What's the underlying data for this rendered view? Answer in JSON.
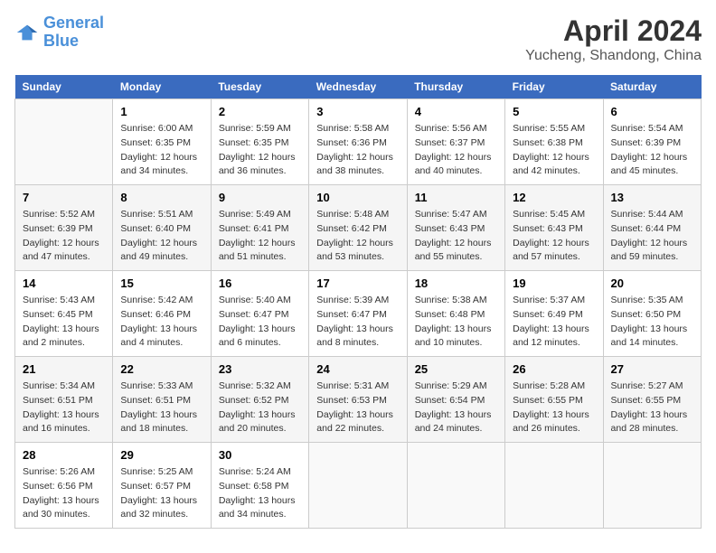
{
  "header": {
    "logo_line1": "General",
    "logo_line2": "Blue",
    "main_title": "April 2024",
    "subtitle": "Yucheng, Shandong, China"
  },
  "days_of_week": [
    "Sunday",
    "Monday",
    "Tuesday",
    "Wednesday",
    "Thursday",
    "Friday",
    "Saturday"
  ],
  "weeks": [
    [
      {
        "day": "",
        "info": ""
      },
      {
        "day": "1",
        "info": "Sunrise: 6:00 AM\nSunset: 6:35 PM\nDaylight: 12 hours\nand 34 minutes."
      },
      {
        "day": "2",
        "info": "Sunrise: 5:59 AM\nSunset: 6:35 PM\nDaylight: 12 hours\nand 36 minutes."
      },
      {
        "day": "3",
        "info": "Sunrise: 5:58 AM\nSunset: 6:36 PM\nDaylight: 12 hours\nand 38 minutes."
      },
      {
        "day": "4",
        "info": "Sunrise: 5:56 AM\nSunset: 6:37 PM\nDaylight: 12 hours\nand 40 minutes."
      },
      {
        "day": "5",
        "info": "Sunrise: 5:55 AM\nSunset: 6:38 PM\nDaylight: 12 hours\nand 42 minutes."
      },
      {
        "day": "6",
        "info": "Sunrise: 5:54 AM\nSunset: 6:39 PM\nDaylight: 12 hours\nand 45 minutes."
      }
    ],
    [
      {
        "day": "7",
        "info": "Sunrise: 5:52 AM\nSunset: 6:39 PM\nDaylight: 12 hours\nand 47 minutes."
      },
      {
        "day": "8",
        "info": "Sunrise: 5:51 AM\nSunset: 6:40 PM\nDaylight: 12 hours\nand 49 minutes."
      },
      {
        "day": "9",
        "info": "Sunrise: 5:49 AM\nSunset: 6:41 PM\nDaylight: 12 hours\nand 51 minutes."
      },
      {
        "day": "10",
        "info": "Sunrise: 5:48 AM\nSunset: 6:42 PM\nDaylight: 12 hours\nand 53 minutes."
      },
      {
        "day": "11",
        "info": "Sunrise: 5:47 AM\nSunset: 6:43 PM\nDaylight: 12 hours\nand 55 minutes."
      },
      {
        "day": "12",
        "info": "Sunrise: 5:45 AM\nSunset: 6:43 PM\nDaylight: 12 hours\nand 57 minutes."
      },
      {
        "day": "13",
        "info": "Sunrise: 5:44 AM\nSunset: 6:44 PM\nDaylight: 12 hours\nand 59 minutes."
      }
    ],
    [
      {
        "day": "14",
        "info": "Sunrise: 5:43 AM\nSunset: 6:45 PM\nDaylight: 13 hours\nand 2 minutes."
      },
      {
        "day": "15",
        "info": "Sunrise: 5:42 AM\nSunset: 6:46 PM\nDaylight: 13 hours\nand 4 minutes."
      },
      {
        "day": "16",
        "info": "Sunrise: 5:40 AM\nSunset: 6:47 PM\nDaylight: 13 hours\nand 6 minutes."
      },
      {
        "day": "17",
        "info": "Sunrise: 5:39 AM\nSunset: 6:47 PM\nDaylight: 13 hours\nand 8 minutes."
      },
      {
        "day": "18",
        "info": "Sunrise: 5:38 AM\nSunset: 6:48 PM\nDaylight: 13 hours\nand 10 minutes."
      },
      {
        "day": "19",
        "info": "Sunrise: 5:37 AM\nSunset: 6:49 PM\nDaylight: 13 hours\nand 12 minutes."
      },
      {
        "day": "20",
        "info": "Sunrise: 5:35 AM\nSunset: 6:50 PM\nDaylight: 13 hours\nand 14 minutes."
      }
    ],
    [
      {
        "day": "21",
        "info": "Sunrise: 5:34 AM\nSunset: 6:51 PM\nDaylight: 13 hours\nand 16 minutes."
      },
      {
        "day": "22",
        "info": "Sunrise: 5:33 AM\nSunset: 6:51 PM\nDaylight: 13 hours\nand 18 minutes."
      },
      {
        "day": "23",
        "info": "Sunrise: 5:32 AM\nSunset: 6:52 PM\nDaylight: 13 hours\nand 20 minutes."
      },
      {
        "day": "24",
        "info": "Sunrise: 5:31 AM\nSunset: 6:53 PM\nDaylight: 13 hours\nand 22 minutes."
      },
      {
        "day": "25",
        "info": "Sunrise: 5:29 AM\nSunset: 6:54 PM\nDaylight: 13 hours\nand 24 minutes."
      },
      {
        "day": "26",
        "info": "Sunrise: 5:28 AM\nSunset: 6:55 PM\nDaylight: 13 hours\nand 26 minutes."
      },
      {
        "day": "27",
        "info": "Sunrise: 5:27 AM\nSunset: 6:55 PM\nDaylight: 13 hours\nand 28 minutes."
      }
    ],
    [
      {
        "day": "28",
        "info": "Sunrise: 5:26 AM\nSunset: 6:56 PM\nDaylight: 13 hours\nand 30 minutes."
      },
      {
        "day": "29",
        "info": "Sunrise: 5:25 AM\nSunset: 6:57 PM\nDaylight: 13 hours\nand 32 minutes."
      },
      {
        "day": "30",
        "info": "Sunrise: 5:24 AM\nSunset: 6:58 PM\nDaylight: 13 hours\nand 34 minutes."
      },
      {
        "day": "",
        "info": ""
      },
      {
        "day": "",
        "info": ""
      },
      {
        "day": "",
        "info": ""
      },
      {
        "day": "",
        "info": ""
      }
    ]
  ]
}
